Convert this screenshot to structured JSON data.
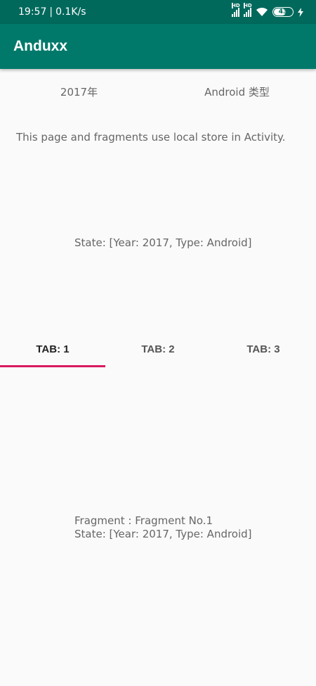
{
  "status_bar": {
    "time": "19:57",
    "separator": "|",
    "speed": "0.1K/s",
    "network_type": "HD",
    "battery": "43"
  },
  "app_bar": {
    "title": "Anduxx"
  },
  "selectors": {
    "year": "2017年",
    "type": "Android 类型"
  },
  "info_text": "This page and fragments use local store in Activity.",
  "state_text": "State: [Year: 2017, Type: Android]",
  "tabs": [
    {
      "label": "TAB: 1",
      "active": true
    },
    {
      "label": "TAB: 2",
      "active": false
    },
    {
      "label": "TAB: 3",
      "active": false
    }
  ],
  "fragment": {
    "title": "Fragment : Fragment No.1",
    "state": "State: [Year: 2017, Type: Android]"
  },
  "colors": {
    "primary": "#00796b",
    "primary_dark": "#00695c",
    "accent": "#d81b60"
  }
}
